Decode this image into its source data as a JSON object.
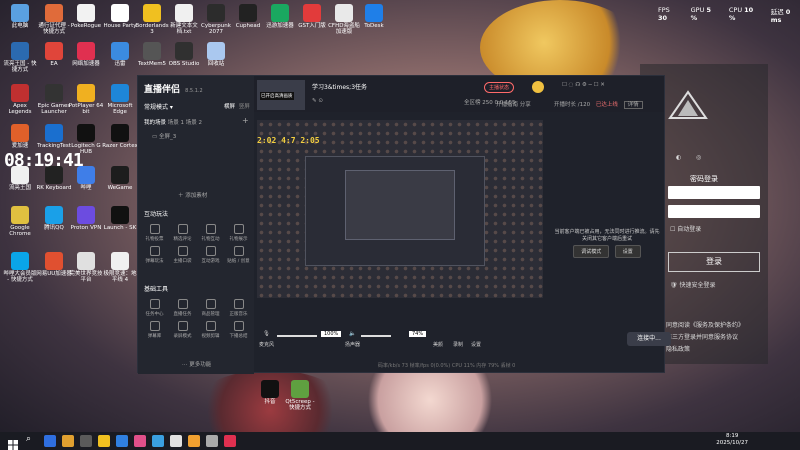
{
  "hud": {
    "fps_label": "FPS",
    "fps_value": "30",
    "gpu_label": "GPU",
    "gpu_value": "5 %",
    "cpu_label": "CPU",
    "cpu_value": "10 %",
    "latency_label": "延迟",
    "latency_value": "0 ms"
  },
  "clock": "08:19:41",
  "desktop_icons": [
    {
      "label": "此电脑",
      "color": "#5aa0e0"
    },
    {
      "label": "通行证代理 - 快捷方式",
      "color": "#e06b3a"
    },
    {
      "label": "PokeRogue",
      "color": "#f2f2f2"
    },
    {
      "label": "House Party",
      "color": "#ffffff"
    },
    {
      "label": "Borderlands 3",
      "color": "#f0c020"
    },
    {
      "label": "新建文本文档.txt",
      "color": "#f0f0f0"
    },
    {
      "label": "Cyberpunk 2077",
      "color": "#2c2c2c"
    },
    {
      "label": "Cuphead",
      "color": "#222"
    },
    {
      "label": "迅游加速器",
      "color": "#1aa860"
    },
    {
      "label": "GST入门版",
      "color": "#e23b3b"
    },
    {
      "label": "CFHD海盗船加速版",
      "color": "#e9e9e9"
    },
    {
      "label": "ToDesk",
      "color": "#1f7fe8"
    },
    {
      "label": "流亮王国 - 快捷方式",
      "color": "#2b6ab0"
    },
    {
      "label": "EA",
      "color": "#e0453a"
    },
    {
      "label": "网络加速器",
      "color": "#e03050"
    },
    {
      "label": "迅雷",
      "color": "#3b8be0"
    },
    {
      "label": "TextMem5",
      "color": "#555"
    },
    {
      "label": "OBS Studio",
      "color": "#303030"
    },
    {
      "label": "回收站",
      "color": "#aac8ef"
    },
    {
      "label": "Apex Legends",
      "color": "#c03030"
    },
    {
      "label": "Epic Games Launcher",
      "color": "#333"
    },
    {
      "label": "PotPlayer 64 bit",
      "color": "#f0b020"
    },
    {
      "label": "Microsoft Edge",
      "color": "#1e86d8"
    },
    {
      "label": "爱加速",
      "color": "#e0602a"
    },
    {
      "label": "TrackingTest",
      "color": "#1a6fcf"
    },
    {
      "label": "Logitech G HUB",
      "color": "#111"
    },
    {
      "label": "Razer Cortex",
      "color": "#111"
    },
    {
      "label": "流亮王国",
      "color": "#f0f0f0"
    },
    {
      "label": "RK Keyboard",
      "color": "#222"
    },
    {
      "label": "哔哩",
      "color": "#3f7ee8"
    },
    {
      "label": "WeGame",
      "color": "#1d1d1d"
    },
    {
      "label": "Google Chrome",
      "color": "#e0c040"
    },
    {
      "label": "腾讯QQ",
      "color": "#1aa0e8"
    },
    {
      "label": "Proton VPN",
      "color": "#6c4ce0"
    },
    {
      "label": "Launch - SK",
      "color": "#111"
    },
    {
      "label": "哔哩大会员版 - 快捷方式",
      "color": "#0aa5e8"
    },
    {
      "label": "网易UU加速器",
      "color": "#e05030"
    },
    {
      "label": "完美世界竞技平台",
      "color": "#e0e0e0"
    },
    {
      "label": "极限竞速：地平线 4",
      "color": "#f0f0f0"
    },
    {
      "label": "抖音",
      "color": "#111"
    },
    {
      "label": "Qt5creep - 快捷方式",
      "color": "#5fa040"
    }
  ],
  "app": {
    "logo": "直播伴侣",
    "version": "8.5.1.2",
    "mode_label": "常规模式",
    "tab_landscape": "横屏",
    "tab_portrait": "竖屏",
    "scene_header": "我的场景",
    "scene1": "场景 1",
    "scene2": "场景 2",
    "scene_item": "全屏_3",
    "add_material": "添加素材",
    "interactive_title": "互动玩法",
    "interactive_tools": [
      "礼物投票",
      "精选评论",
      "礼物互动",
      "礼物展示",
      "弹幕玩法",
      "主播口袋",
      "互动游戏",
      "贴纸 / 创意"
    ],
    "basic_title": "基础工具",
    "basic_tools": [
      "任务中心",
      "直播任务",
      "商品管理",
      "正版音乐",
      "弹幕库",
      "录屏模式",
      "视频剪辑",
      "下播总结"
    ],
    "more_label": "更多功能",
    "stream_title": "学习3&times;3任务",
    "stream_tag": "已开启高清画质",
    "stream_stats": [
      "全区榜",
      "250",
      "0",
      "0",
      "155"
    ],
    "stage_text": "2:02 4:7 2:05",
    "badge_start": "主播状态",
    "top_links": [
      "开播指南",
      "分享"
    ],
    "duration_label": "开播时长",
    "duration_value": "/120",
    "right_label": "已达上线",
    "detail_btn": "详情",
    "side_message": "当前客户端已被占用，无法同时进行推流。请先关闭其它客户端后重试",
    "side_btn1": "调试模式",
    "side_btn2": "设置",
    "mic_label": "麦克风",
    "mic_value": "100%",
    "speaker_label": "扬声器",
    "speaker_value": "74%",
    "beauty": "美颜",
    "record": "录制",
    "settings": "设置",
    "connect_btn": "连接中...",
    "status_bar": [
      "码率/kb/s",
      "73",
      "帧率/fps",
      "0(0.0%)",
      "CPU 11%",
      "内存 79%",
      "丢帧 0"
    ]
  },
  "login": {
    "title": "密码登录",
    "auto_login": "自动登录",
    "login_btn": "登录",
    "fast_login": "快速安全登录",
    "agreement_lines": [
      "同意阅读《服务及保护条约》",
      "第三方登录并同意服务协议",
      "隐私政策"
    ]
  },
  "taskbar": {
    "time": "8:19",
    "date": "2025/10/27",
    "icons": [
      "#2f6fe0",
      "#e0a030",
      "#5a5a5a",
      "#f0c020",
      "#3080e0",
      "#e0508a",
      "#3aa0e0",
      "#e0e0e0",
      "#f0a030",
      "#aaaaaa",
      "#e03050"
    ]
  }
}
